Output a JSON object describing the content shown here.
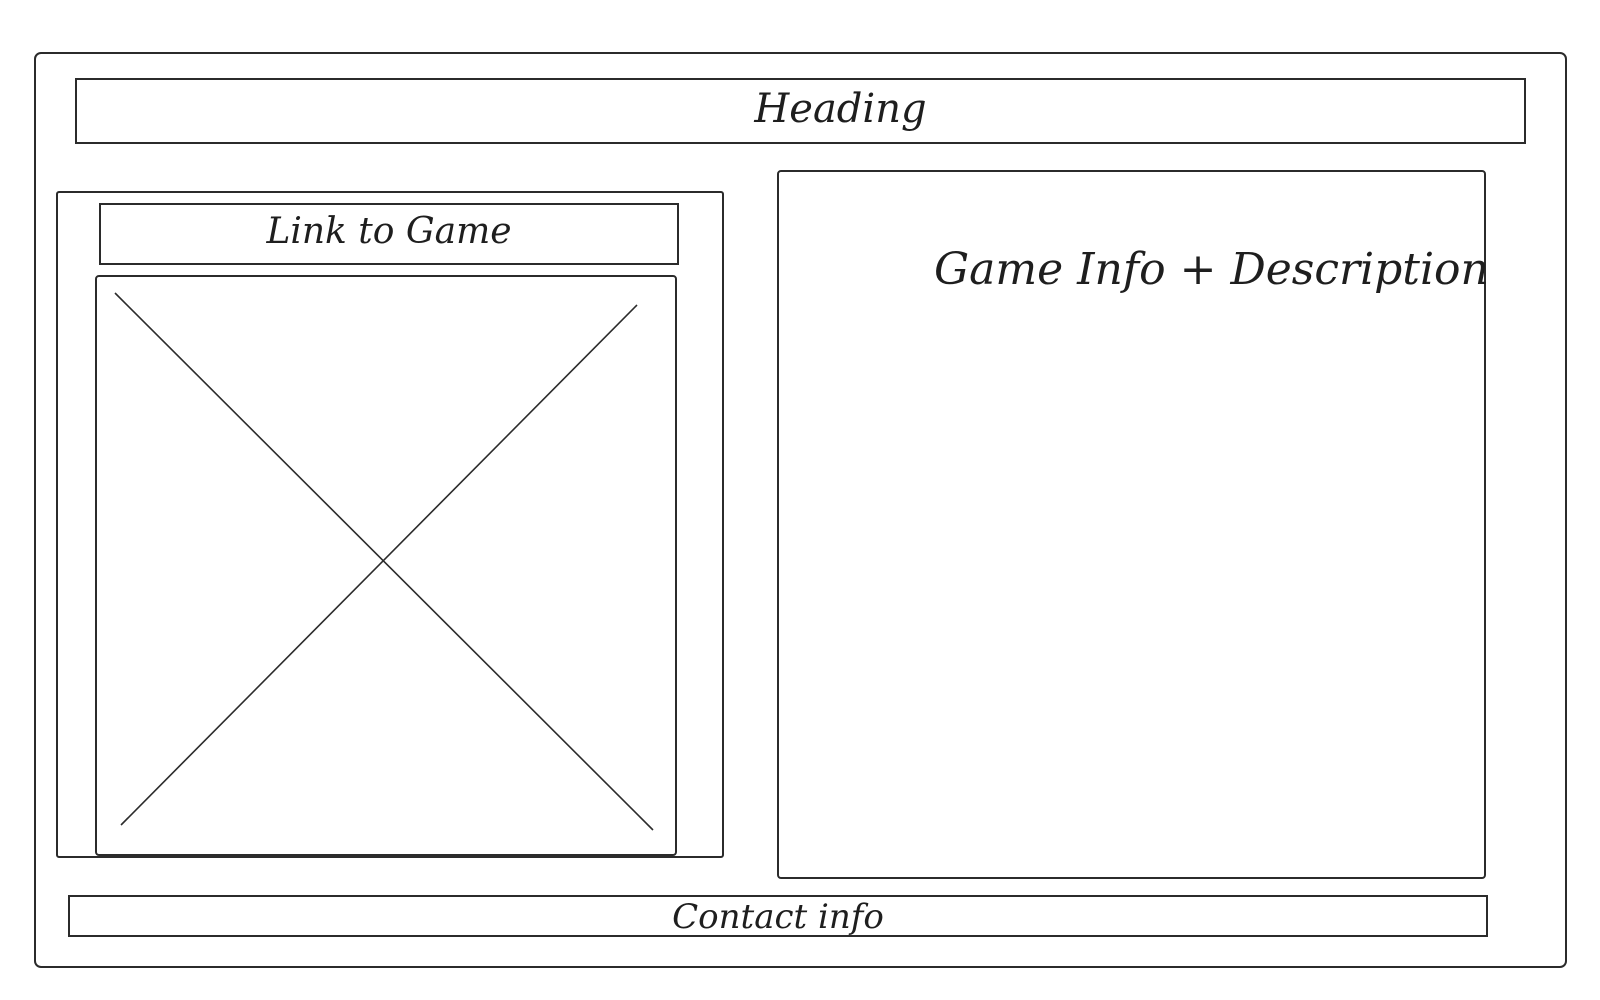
{
  "header": {
    "title": "Heading"
  },
  "left_panel": {
    "link_label": "Link to Game",
    "image_icon": "image-placeholder-cross-icon"
  },
  "info_panel": {
    "title": "Game Info + Description"
  },
  "footer": {
    "contact_label": "Contact info"
  },
  "colors": {
    "stroke": "#2b2b2b",
    "background": "#ffffff"
  }
}
